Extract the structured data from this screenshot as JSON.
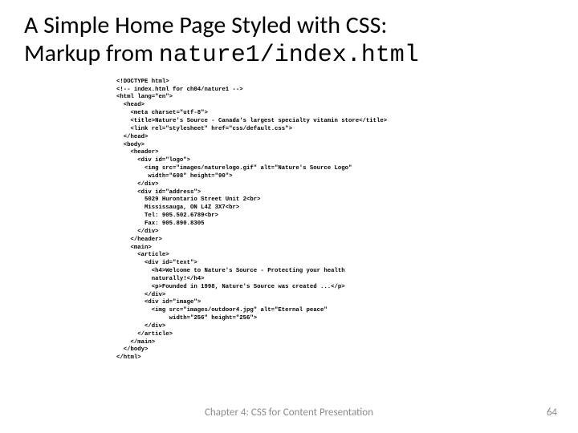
{
  "title": {
    "line1": "A Simple Home Page Styled with CSS:",
    "line2_prefix": "Markup from ",
    "line2_mono": "nature1/index.html"
  },
  "code": {
    "l01": "<!DOCTYPE html>",
    "l02": "<!-- index.html for ch04/nature1 -->",
    "l03": "<html lang=\"en\">",
    "l04": "  <head>",
    "l05": "    <meta charset=\"utf-8\">",
    "l06": "    <title>Nature's Source - Canada's largest specialty vitamin store</title>",
    "l07": "    <link rel=\"stylesheet\" href=\"css/default.css\">",
    "l08": "  </head>",
    "l09": "  <body>",
    "l10": "    <header>",
    "l11": "      <div id=\"logo\">",
    "l12": "        <img src=\"images/naturelogo.gif\" alt=\"Nature's Source Logo\"",
    "l13": "         width=\"608\" height=\"90\">",
    "l14": "      </div>",
    "l15": "      <div id=\"address\">",
    "l16": "        5029 Hurontario Street Unit 2<br>",
    "l17": "        Mississauga, ON L4Z 3X7<br>",
    "l18": "        Tel: 905.502.6789<br>",
    "l19": "        Fax: 905.890.8305",
    "l20": "      </div>",
    "l21": "    </header>",
    "l22": "    <main>",
    "l23": "      <article>",
    "l24": "        <div id=\"text\">",
    "l25": "          <h4>Welcome to Nature's Source - Protecting your health",
    "l26": "          naturally!</h4>",
    "l27": "          <p>Founded in 1998, Nature's Source was created ...</p>",
    "l28": "        </div>",
    "l29": "        <div id=\"image\">",
    "l30": "          <img src=\"images/outdoor4.jpg\" alt=\"Eternal peace\"",
    "l31": "               width=\"256\" height=\"256\">",
    "l32": "        </div>",
    "l33": "      </article>",
    "l34": "    </main>",
    "l35": "  </body>",
    "l36": "</html>"
  },
  "footer": {
    "chapter": "Chapter 4: CSS for Content Presentation",
    "page": "64"
  }
}
